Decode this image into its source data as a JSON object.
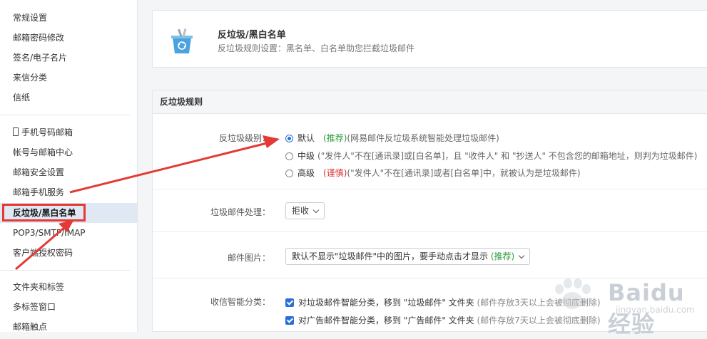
{
  "sidebar": {
    "group1": [
      "常规设置",
      "邮箱密码修改",
      "签名/电子名片",
      "来信分类",
      "信纸"
    ],
    "group2": [
      "手机号码邮箱",
      "帐号与邮箱中心",
      "邮箱安全设置",
      "邮箱手机服务",
      "反垃圾/黑白名单",
      "POP3/SMTP/IMAP",
      "客户端授权密码"
    ],
    "group3": [
      "文件夹和标签",
      "多标签窗口",
      "邮箱触点"
    ],
    "active_item": "反垃圾/黑白名单",
    "icons": {
      "phone": "phone-icon"
    }
  },
  "header": {
    "title": "反垃圾/黑白名单",
    "description": "反垃圾规则设置：黑名单、白名单助您拦截垃圾邮件",
    "icon": "trash-bin-icon"
  },
  "rules": {
    "section_title": "反垃圾规则",
    "level": {
      "label": "反垃圾级别：",
      "options": [
        {
          "name": "默认",
          "tag": "(推荐)",
          "desc": "(网易邮件反垃圾系统智能处理垃圾邮件)",
          "checked": true
        },
        {
          "name": "中级",
          "tag": "",
          "desc": "(\"发件人\"不在[通讯录]或[白名单]，且 \"收件人\" 和 \"抄送人\" 不包含您的邮箱地址，则判为垃圾邮件)",
          "checked": false
        },
        {
          "name": "高级",
          "tag": "(谨慎)",
          "desc": "(\"发件人\"不在[通讯录]或者[白名单]中，就被认为是垃圾邮件)",
          "checked": false
        }
      ]
    },
    "spam_handling": {
      "label": "垃圾邮件处理：",
      "value": "拒收"
    },
    "images": {
      "label": "邮件图片：",
      "value": "默认不显示\"垃圾邮件\"中的图片，要手动点击才显示",
      "tag": "(推荐)"
    },
    "smart_sort": {
      "label": "收信智能分类：",
      "items": [
        {
          "text": "对垃圾邮件智能分类，移到 \"垃圾邮件\" 文件夹",
          "note": "(邮件存放3天以上会被彻底删除)",
          "checked": true
        },
        {
          "text": "对广告邮件智能分类，移到 \"广告邮件\" 文件夹",
          "note": "(邮件存放7天以上会被彻底删除)",
          "checked": true
        }
      ]
    }
  },
  "watermark": {
    "brand": "Baidu经验",
    "sub": "jingyan.baidu.com"
  },
  "colors": {
    "accent": "#2b6fd6",
    "recommend": "#2e9b3a",
    "caution": "#d32f2f",
    "annotation": "#e53935",
    "active_bg": "#dfe8f3"
  }
}
